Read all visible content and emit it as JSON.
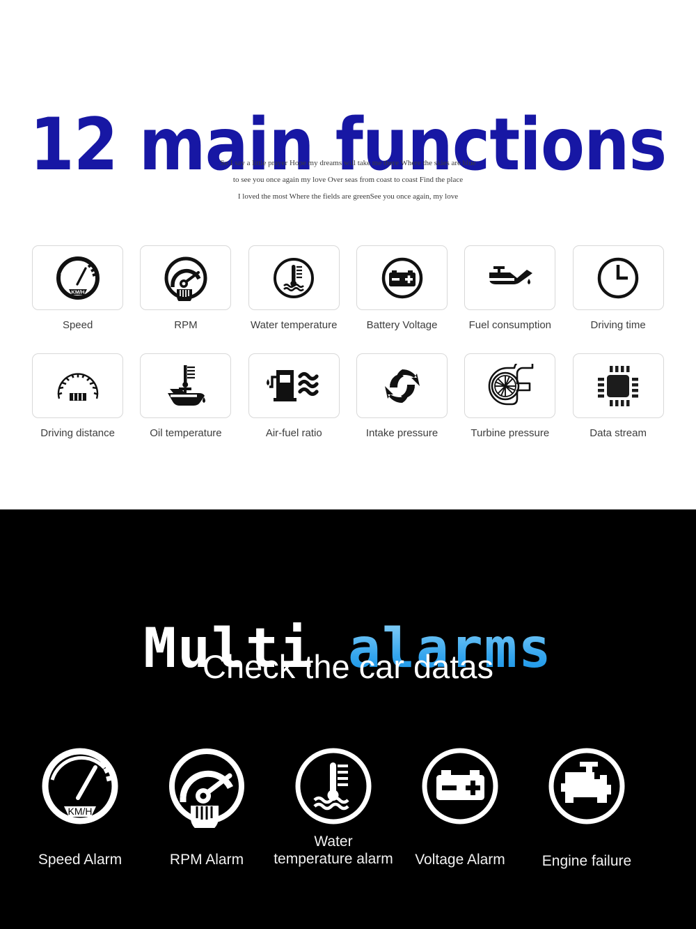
{
  "functions_section": {
    "title": "12 main functions",
    "title_color": "#1717A4",
    "background": "#ffffff",
    "subtitle_lines": [
      "So I say a little prayer Hope my dreams will take me there Where the skies are blue",
      "to see you once again my love Over seas from coast to coast Find the place",
      "I loved the most Where the fields are greenSee you once again, my love"
    ],
    "items": [
      {
        "label": "Speed",
        "icon": "speedometer-icon",
        "gauge_text": "KM/H"
      },
      {
        "label": "RPM",
        "icon": "tachometer-icon",
        "gauge_text": ""
      },
      {
        "label": "Water temperature",
        "icon": "water-temperature-icon",
        "gauge_text": ""
      },
      {
        "label": "Battery Voltage",
        "icon": "battery-icon",
        "gauge_text": ""
      },
      {
        "label": "Fuel consumption",
        "icon": "oil-can-icon",
        "gauge_text": ""
      },
      {
        "label": "Driving time",
        "icon": "clock-icon",
        "gauge_text": ""
      },
      {
        "label": "Driving distance",
        "icon": "odometer-icon",
        "gauge_text": ""
      },
      {
        "label": "Oil temperature",
        "icon": "oil-temperature-icon",
        "gauge_text": ""
      },
      {
        "label": "Air-fuel ratio",
        "icon": "fuel-pump-air-icon",
        "gauge_text": ""
      },
      {
        "label": "Intake pressure",
        "icon": "recycle-arrows-icon",
        "gauge_text": ""
      },
      {
        "label": "Turbine pressure",
        "icon": "turbocharger-icon",
        "gauge_text": ""
      },
      {
        "label": "Data stream",
        "icon": "chip-icon",
        "gauge_text": ""
      }
    ]
  },
  "alarms_section": {
    "background": "#000000",
    "title_part_white": "Multi",
    "title_part_blue": " alarms",
    "title_blue_color": "#36A6EE",
    "subtitle": "Check the car datas",
    "items": [
      {
        "label": "Speed Alarm",
        "icon": "speedometer-alarm-icon",
        "gauge_text": "KM/H"
      },
      {
        "label": "RPM Alarm",
        "icon": "tachometer-alarm-icon",
        "gauge_text": ""
      },
      {
        "label": "Water\ntemperature alarm",
        "icon": "water-temperature-alarm-icon",
        "gauge_text": ""
      },
      {
        "label": "Voltage Alarm",
        "icon": "battery-alarm-icon",
        "gauge_text": ""
      },
      {
        "label": "Engine failure",
        "icon": "engine-failure-icon",
        "gauge_text": ""
      }
    ]
  }
}
